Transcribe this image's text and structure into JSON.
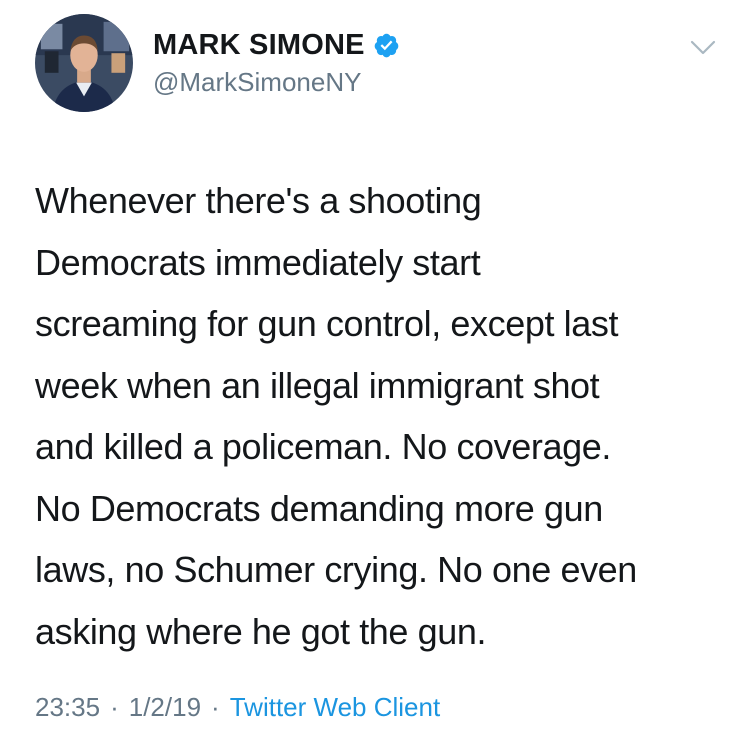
{
  "author": {
    "display_name": "MARK SIMONE",
    "handle": "@MarkSimoneNY",
    "verified": true,
    "avatar_icon": "profile-photo-man-in-studio"
  },
  "tweet": {
    "text": "Whenever there's a shooting\nDemocrats immediately start\nscreaming for gun control, except last\nweek when an illegal immigrant shot\nand killed a policeman. No coverage.\nNo Democrats demanding more gun\nlaws, no Schumer crying. No one even\nasking where he got the gun.",
    "time": "23:35",
    "date": "1/2/19",
    "separator": "·",
    "client": "Twitter Web Client"
  },
  "icons": {
    "verified": "verified-badge-icon",
    "menu": "chevron-down-icon"
  },
  "colors": {
    "text": "#14171a",
    "secondary": "#657786",
    "link": "#1b95e0",
    "verified": "#1da1f2"
  }
}
